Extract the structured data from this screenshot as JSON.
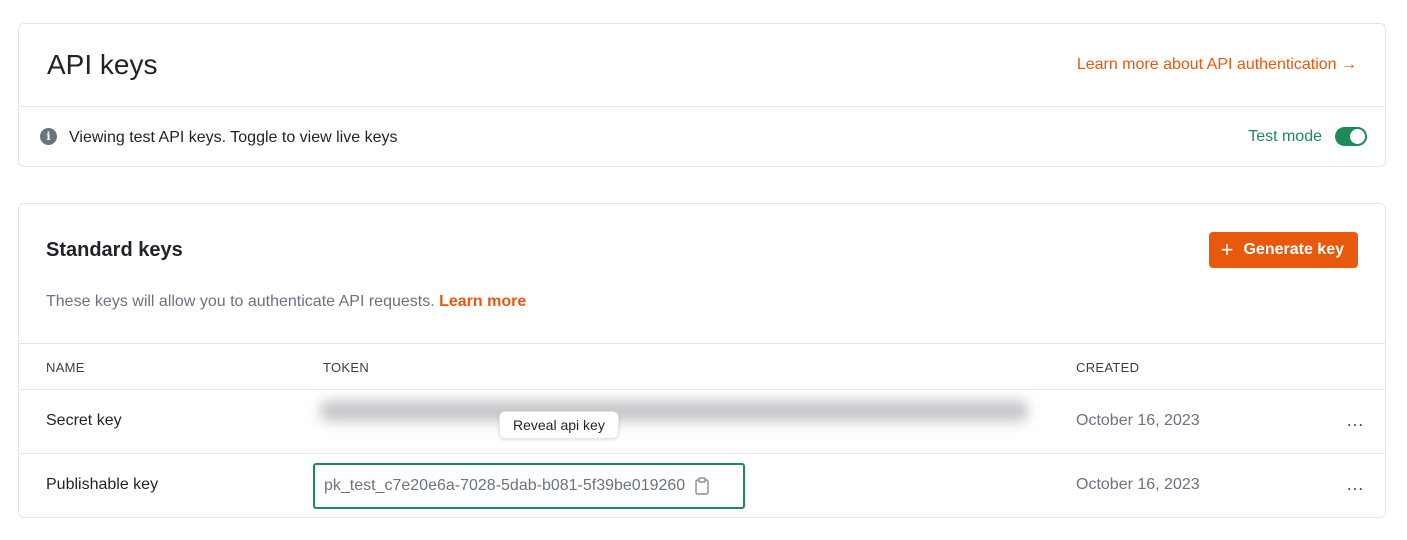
{
  "api_card": {
    "title": "API keys",
    "learn_link": "Learn more about API authentication →",
    "info_text": "Viewing test API keys. Toggle to view live keys",
    "mode_label": "Test mode",
    "test_mode_enabled": true
  },
  "standard_keys": {
    "title": "Standard keys",
    "generate_label": "Generate key",
    "description": "These keys will allow you to authenticate API requests.",
    "learn_more": "Learn more",
    "columns": {
      "name": "NAME",
      "token": "TOKEN",
      "created": "CREATED"
    },
    "rows": [
      {
        "name": "Secret key",
        "token_hidden": true,
        "created": "October 16, 2023"
      },
      {
        "name": "Publishable key",
        "token": "pk_test_c7e20e6a-7028-5dab-b081-5f39be019260",
        "created": "October 16, 2023"
      }
    ],
    "tooltip": "Reveal api key",
    "more_icon": "…"
  },
  "colors": {
    "accent": "#e8590c",
    "success": "#1e8a5a",
    "muted": "#6b7280"
  }
}
